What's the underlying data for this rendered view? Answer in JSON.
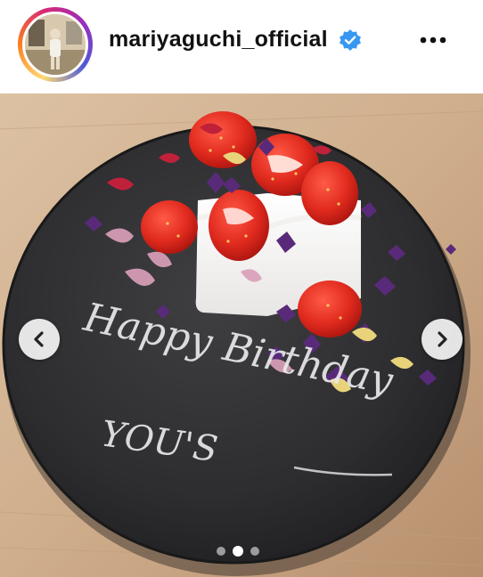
{
  "post_header": {
    "username": "mariyaguchi_official",
    "verified": true,
    "avatar_icon": "profile-photo",
    "more_icon": "more-horizontal-icon"
  },
  "carousel": {
    "prev_icon": "chevron-left-icon",
    "next_icon": "chevron-right-icon",
    "total_slides": 3,
    "active_slide": 2
  },
  "photo": {
    "plate_message": [
      "Happy Birthday",
      "YOU'S"
    ]
  },
  "colors": {
    "verified_blue": "#3897f0",
    "ring_gradient": [
      "#feda75",
      "#fa7e1e",
      "#d62976",
      "#962fbf",
      "#4f5bd5"
    ]
  }
}
